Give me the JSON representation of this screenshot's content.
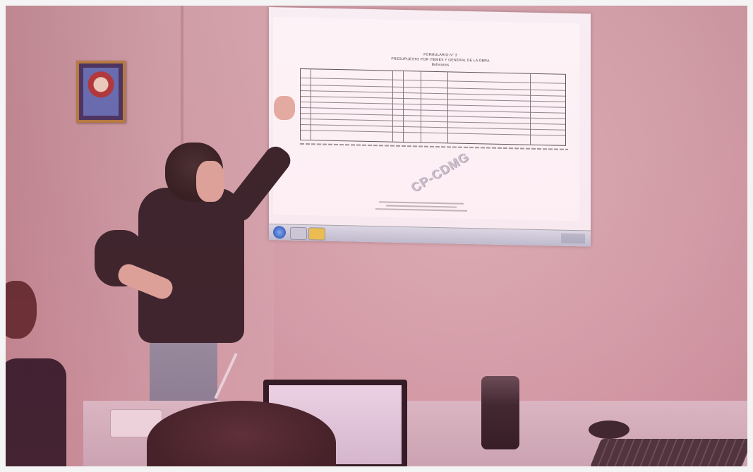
{
  "scene": {
    "description_tokens": [
      "classroom",
      "projector",
      "presenter",
      "spreadsheet"
    ]
  },
  "projected_document": {
    "title_line1": "FORMULARIO N° 3",
    "title_line2": "PRESUPUESTO POR ITEMES Y GENERAL DE LA OBRA",
    "title_line3": "Bolivianos",
    "stamp": "CP-CDMG"
  },
  "colors": {
    "wall": "#cfa0a8",
    "screen": "#f7f7fb",
    "taskbar": "#c6d0dd"
  },
  "icons": {
    "start": "windows-start-icon",
    "app1": "explorer-icon",
    "app2": "folder-icon"
  }
}
